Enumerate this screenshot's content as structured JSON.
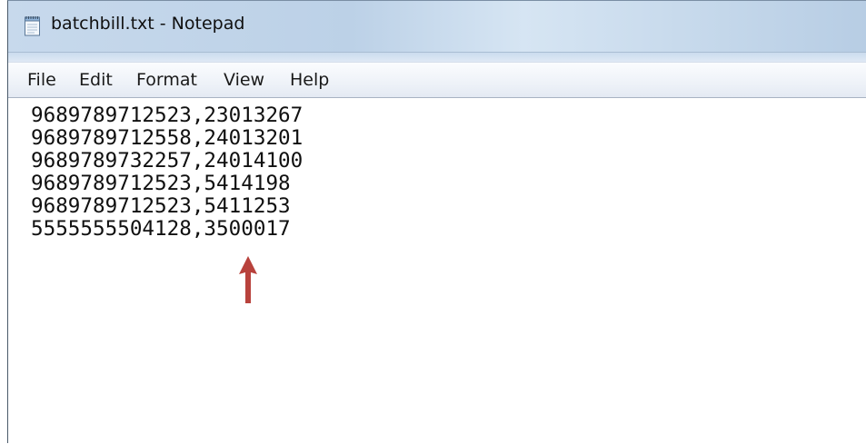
{
  "window": {
    "title": "batchbill.txt - Notepad"
  },
  "menu": {
    "items": [
      "File",
      "Edit",
      "Format",
      "View",
      "Help"
    ]
  },
  "editor": {
    "lines": [
      "9689789712523,23013267",
      "9689789712558,24013201",
      "9689789732257,24014100",
      "9689789712523,5414198",
      "9689789712523,5411253",
      "5555555504128,3500017"
    ]
  },
  "icons": {
    "app": "notepad-icon",
    "annotation": "red-arrow-up-icon"
  },
  "colors": {
    "arrow": "#b8423c",
    "titlebar": "#c7d9ec",
    "menubar": "#eef2f8"
  }
}
